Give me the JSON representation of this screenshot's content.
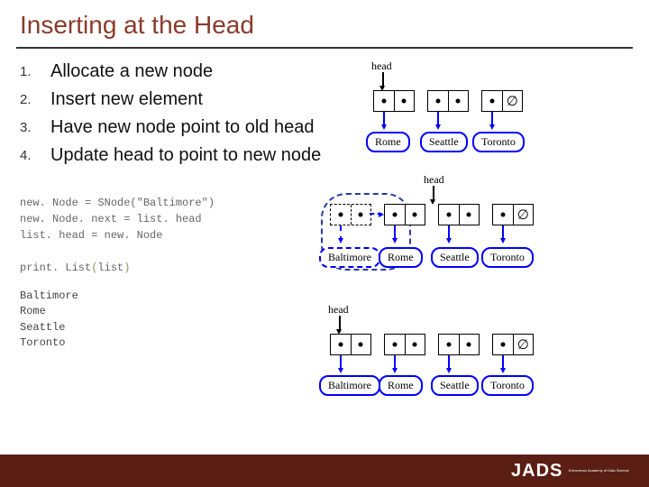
{
  "title": "Inserting at the Head",
  "steps": [
    "Allocate a new node",
    "Insert new element",
    "Have new node point to old head",
    "Update head to point to new node"
  ],
  "code_lines": [
    "new. Node = SNode(\"Baltimore\")",
    "new. Node. next = list. head",
    "list. head = new. Node",
    "",
    "print. List(list)"
  ],
  "output_lines": [
    "Baltimore",
    "Rome",
    "Seattle",
    "Toronto"
  ],
  "diagrams": {
    "head_label": "head",
    "null_glyph": "∅",
    "d1": {
      "cities": [
        "Rome",
        "Seattle",
        "Toronto"
      ]
    },
    "d2": {
      "cities": [
        "Baltimore",
        "Rome",
        "Seattle",
        "Toronto"
      ]
    },
    "d3": {
      "cities": [
        "Baltimore",
        "Rome",
        "Seattle",
        "Toronto"
      ]
    }
  },
  "logo": {
    "mark": "JADS",
    "sub": "Jheronimus\nAcademy\nof Data Science"
  }
}
